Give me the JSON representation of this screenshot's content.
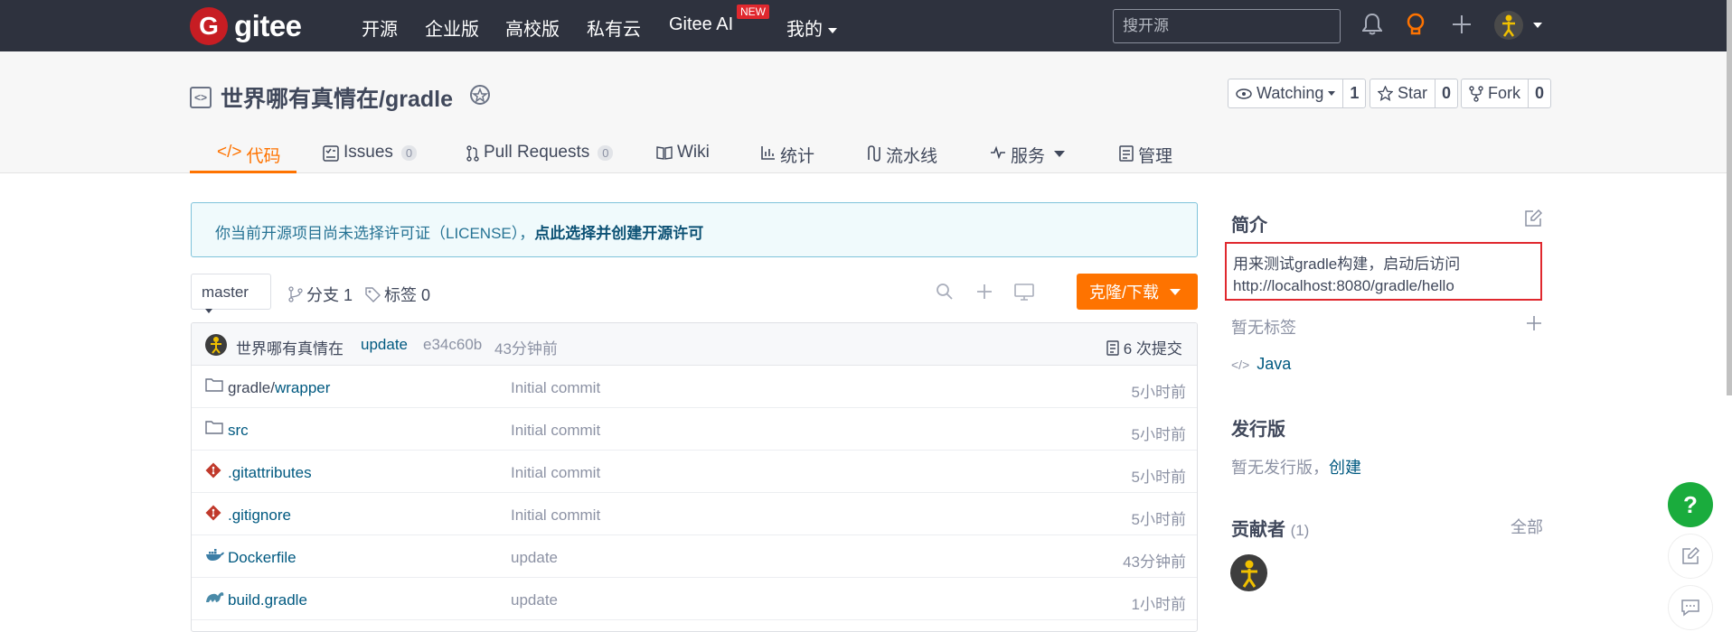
{
  "topnav": {
    "logo_text": "gitee",
    "logo_mark": "G",
    "items": [
      "开源",
      "企业版",
      "高校版",
      "私有云",
      "Gitee AI",
      "我的"
    ],
    "new_badge": "NEW",
    "search_placeholder": "搜开源",
    "icons": [
      "bell-icon",
      "lightbulb-icon",
      "plus-icon",
      "avatar"
    ]
  },
  "project": {
    "title": "世界哪有真情在/gradle",
    "watching_label": "Watching",
    "watching_count": "1",
    "star_label": "Star",
    "star_count": "0",
    "fork_label": "Fork",
    "fork_count": "0"
  },
  "tabs": [
    {
      "label": "代码",
      "count": ""
    },
    {
      "label": "Issues",
      "count": "0"
    },
    {
      "label": "Pull Requests",
      "count": "0"
    },
    {
      "label": "Wiki",
      "count": ""
    },
    {
      "label": "统计",
      "count": ""
    },
    {
      "label": "流水线",
      "count": ""
    },
    {
      "label": "服务",
      "count": ""
    },
    {
      "label": "管理",
      "count": ""
    }
  ],
  "license_notice": {
    "text": "你当前开源项目尚未选择许可证（LICENSE），",
    "link": "点此选择并创建开源许可"
  },
  "branch": {
    "current": "master",
    "branches_label": "分支 1",
    "tags_label": "标签 0",
    "clone_label": "克隆/下载"
  },
  "last_commit": {
    "author": "世界哪有真情在",
    "message": "update",
    "hash": "e34c60b",
    "time": "43分钟前",
    "total": "6 次提交"
  },
  "files": [
    {
      "dir": "gradle/",
      "name": "wrapper",
      "type": "folder",
      "message": "Initial commit",
      "time": "5小时前"
    },
    {
      "dir": "",
      "name": "src",
      "type": "folder",
      "message": "Initial commit",
      "time": "5小时前"
    },
    {
      "dir": "",
      "name": ".gitattributes",
      "type": "git",
      "message": "Initial commit",
      "time": "5小时前"
    },
    {
      "dir": "",
      "name": ".gitignore",
      "type": "git",
      "message": "Initial commit",
      "time": "5小时前"
    },
    {
      "dir": "",
      "name": "Dockerfile",
      "type": "docker",
      "message": "update",
      "time": "43分钟前"
    },
    {
      "dir": "",
      "name": "build.gradle",
      "type": "gradle",
      "message": "update",
      "time": "1小时前"
    }
  ],
  "sidebar": {
    "intro_title": "简介",
    "description": "用来测试gradle构建，启动后访问http://localhost:8080/gradle/hello",
    "no_tags": "暂无标签",
    "language": "Java",
    "release_title": "发行版",
    "no_release": "暂无发行版，",
    "create_link": "创建",
    "contributors_title": "贡献者",
    "contributors_count": "(1)",
    "all_link": "全部"
  },
  "floating": {
    "help": "?"
  }
}
